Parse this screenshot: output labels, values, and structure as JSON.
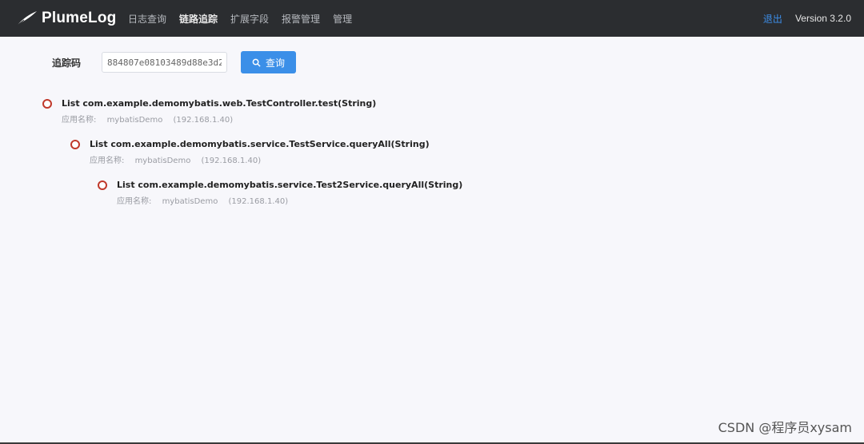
{
  "header": {
    "logo_text": "PlumeLog",
    "nav": [
      {
        "label": "日志查询",
        "active": false
      },
      {
        "label": "链路追踪",
        "active": true
      },
      {
        "label": "扩展字段",
        "active": false
      },
      {
        "label": "报警管理",
        "active": false
      },
      {
        "label": "管理",
        "active": false
      }
    ],
    "logout_label": "退出",
    "version": "Version 3.2.0"
  },
  "search": {
    "label": "追踪码",
    "value": "884807e08103489d88e3d2",
    "button_label": "查询",
    "button_icon": "search-icon",
    "button_color": "#3b8fe8"
  },
  "trace": [
    {
      "method": "List com.example.demomybatis.web.TestController.test(String)",
      "app_label": "应用名称:",
      "app_name": "mybatisDemo",
      "ip": "(192.168.1.40)"
    },
    {
      "method": "List com.example.demomybatis.service.TestService.queryAll(String)",
      "app_label": "应用名称:",
      "app_name": "mybatisDemo",
      "ip": "(192.168.1.40)"
    },
    {
      "method": "List com.example.demomybatis.service.Test2Service.queryAll(String)",
      "app_label": "应用名称:",
      "app_name": "mybatisDemo",
      "ip": "(192.168.1.40)"
    }
  ],
  "watermark": "CSDN @程序员xysam",
  "colors": {
    "header_bg": "#2b2d30",
    "accent": "#3b8fe8",
    "bullet": "#c0392b"
  }
}
